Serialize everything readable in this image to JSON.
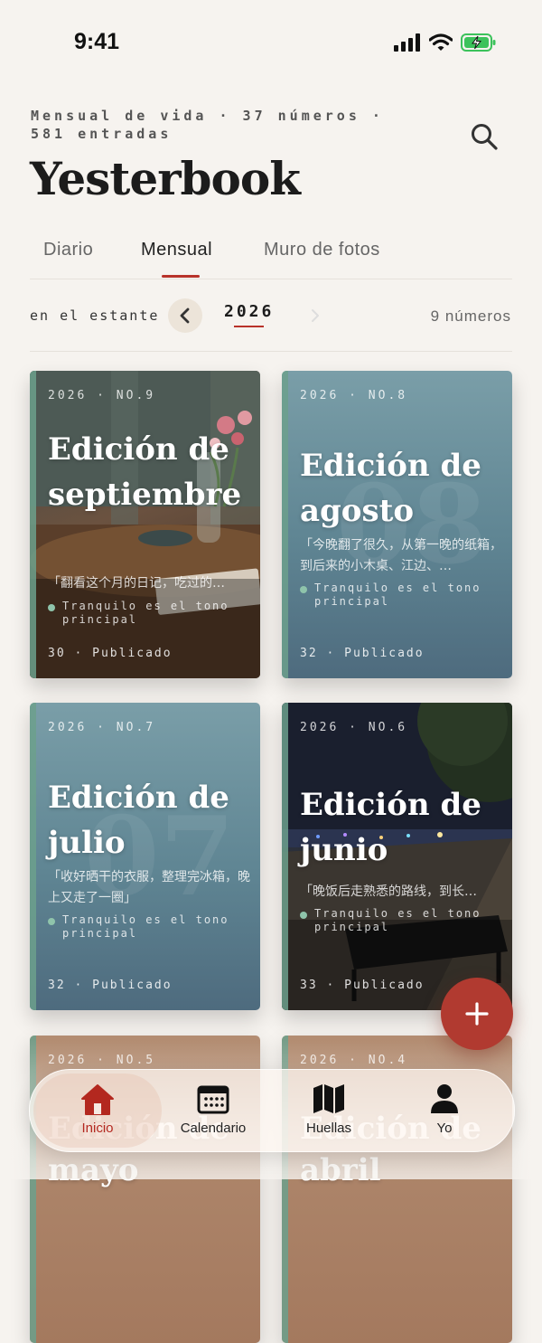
{
  "status_bar": {
    "time": "9:41"
  },
  "header": {
    "subtitle": "Mensual de vida · 37 números · 581 entradas",
    "title": "Yesterbook"
  },
  "tabs": [
    {
      "label": "Diario"
    },
    {
      "label": "Mensual"
    },
    {
      "label": "Muro de fotos"
    }
  ],
  "active_tab": "Mensual",
  "shelf": {
    "label": "en el estante",
    "year": "2026",
    "count": "9 números"
  },
  "issues": [
    {
      "meta": "2026 · NO.9",
      "title": "Edición de septiembre",
      "quote": "「翻看这个月的日记，吃过的…",
      "tone": "Tranquilo es el tono principal",
      "footer": "30 · Publicado"
    },
    {
      "meta": "2026 · NO.8",
      "title": "Edición de agosto",
      "quote": "「今晚翻了很久，从第一晚的纸箱，到后来的小木桌、江边、…",
      "tone": "Tranquilo es el tono principal",
      "footer": "32 · Publicado"
    },
    {
      "meta": "2026 · NO.7",
      "title": "Edición de julio",
      "quote": "「收好晒干的衣服，整理完冰箱，晚上又走了一圈」",
      "tone": "Tranquilo es el tono principal",
      "footer": "32 · Publicado"
    },
    {
      "meta": "2026 · NO.6",
      "title": "Edición de junio",
      "quote": "「晚饭后走熟悉的路线，到长…",
      "tone": "Tranquilo es el tono principal",
      "footer": "33 · Publicado"
    },
    {
      "meta": "2026 · NO.5",
      "title": "Edición de mayo"
    },
    {
      "meta": "2026 · NO.4",
      "title": "Edición de abril"
    }
  ],
  "nav": [
    {
      "label": "Inicio",
      "icon": "home-icon"
    },
    {
      "label": "Calendario",
      "icon": "calendar-icon"
    },
    {
      "label": "Huellas",
      "icon": "map-icon"
    },
    {
      "label": "Yo",
      "icon": "person-icon"
    }
  ],
  "colors": {
    "accent": "#b8322a",
    "fab": "#b13a30",
    "background": "#f6f3ef"
  }
}
